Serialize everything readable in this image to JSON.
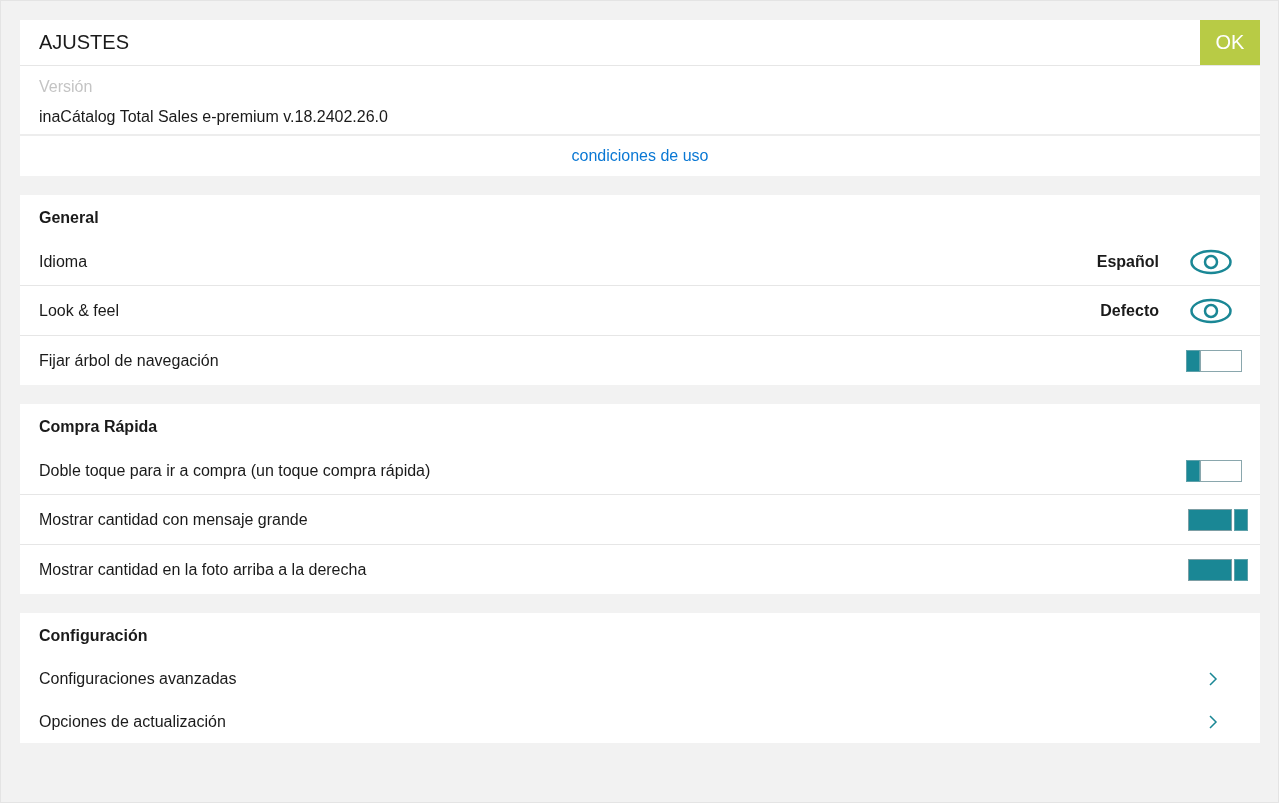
{
  "header": {
    "title": "AJUSTES",
    "ok_button": "OK"
  },
  "version": {
    "label": "Versión",
    "value": "inaCátalog Total Sales e-premium v.18.2402.26.0"
  },
  "terms_link": "condiciones de uso",
  "sections": [
    {
      "title": "General",
      "rows": [
        {
          "kind": "select",
          "label": "Idioma",
          "value": "Español"
        },
        {
          "kind": "select",
          "label": "Look & feel",
          "value": "Defecto"
        },
        {
          "kind": "toggle",
          "label": "Fijar árbol de navegación",
          "on": false
        }
      ]
    },
    {
      "title": "Compra Rápida",
      "rows": [
        {
          "kind": "toggle",
          "label": "Doble toque para ir a compra (un toque compra rápida)",
          "on": false
        },
        {
          "kind": "toggle",
          "label": "Mostrar cantidad con mensaje grande",
          "on": true
        },
        {
          "kind": "toggle",
          "label": "Mostrar cantidad en la foto arriba a la derecha",
          "on": true
        }
      ]
    },
    {
      "title": "Configuración",
      "rows": [
        {
          "kind": "link",
          "label": "Configuraciones avanzadas"
        },
        {
          "kind": "link",
          "label": "Opciones de actualización"
        }
      ]
    }
  ]
}
